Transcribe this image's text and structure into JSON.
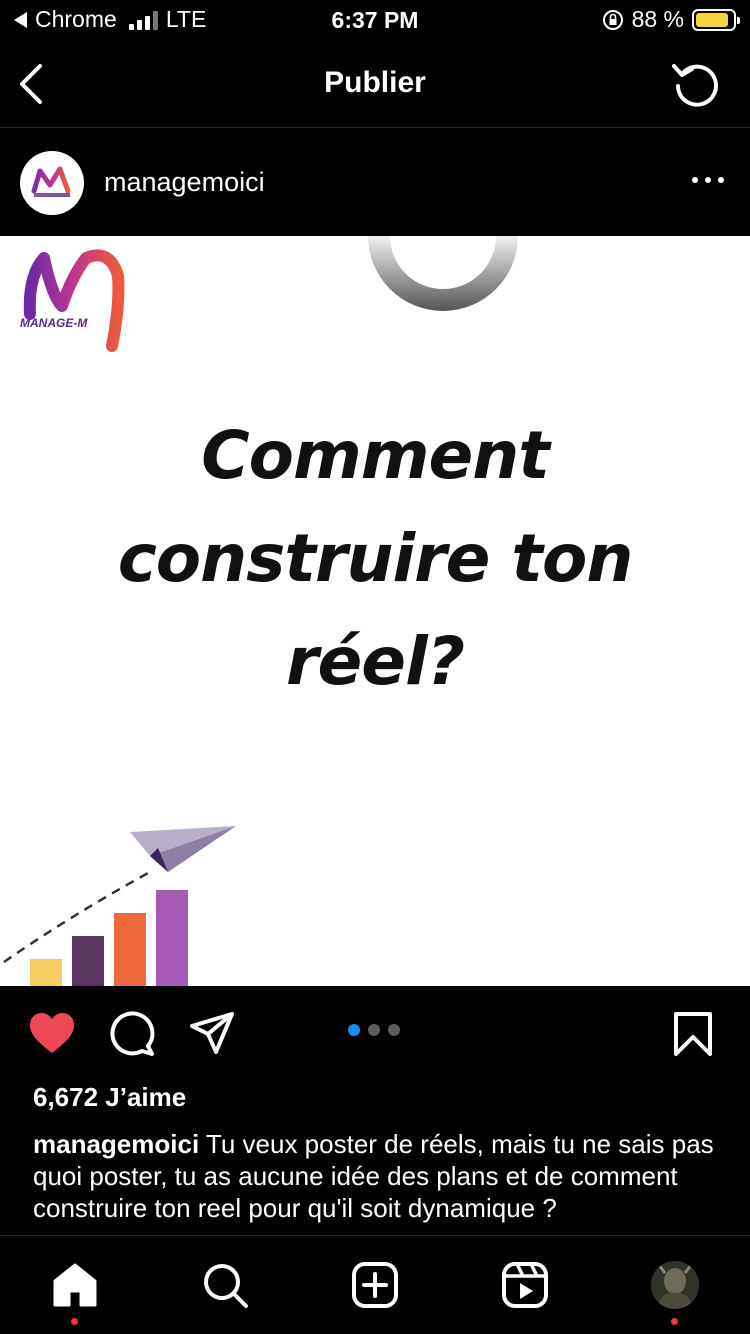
{
  "status_bar": {
    "back_app": "Chrome",
    "network": "LTE",
    "time": "6:37 PM",
    "battery_percent": "88 %",
    "battery_level": 0.88
  },
  "header": {
    "title": "Publier"
  },
  "post": {
    "username": "managemoici",
    "logo_text": "MANAGE-M",
    "image_text_lines": [
      "Comment",
      "construire ton",
      "réel?"
    ],
    "carousel": {
      "count": 3,
      "active_index": 0
    },
    "likes_text": "6,672 J’aime",
    "caption_user": "managemoici",
    "caption_text": "Tu veux poster de réels, mais tu ne sais pas quoi poster, tu as aucune idée des plans et de comment construire ton reel pour qu'il soit dynamique ?"
  },
  "tabbar": {
    "items": [
      "home",
      "search",
      "create",
      "reels",
      "profile"
    ],
    "dots_on": [
      "home",
      "profile"
    ]
  },
  "colors": {
    "background": "#000000",
    "like_red": "#ed4956",
    "carousel_active": "#1a8cf0",
    "battery_yellow": "#f5d33e",
    "notification_dot": "#ff3040"
  }
}
